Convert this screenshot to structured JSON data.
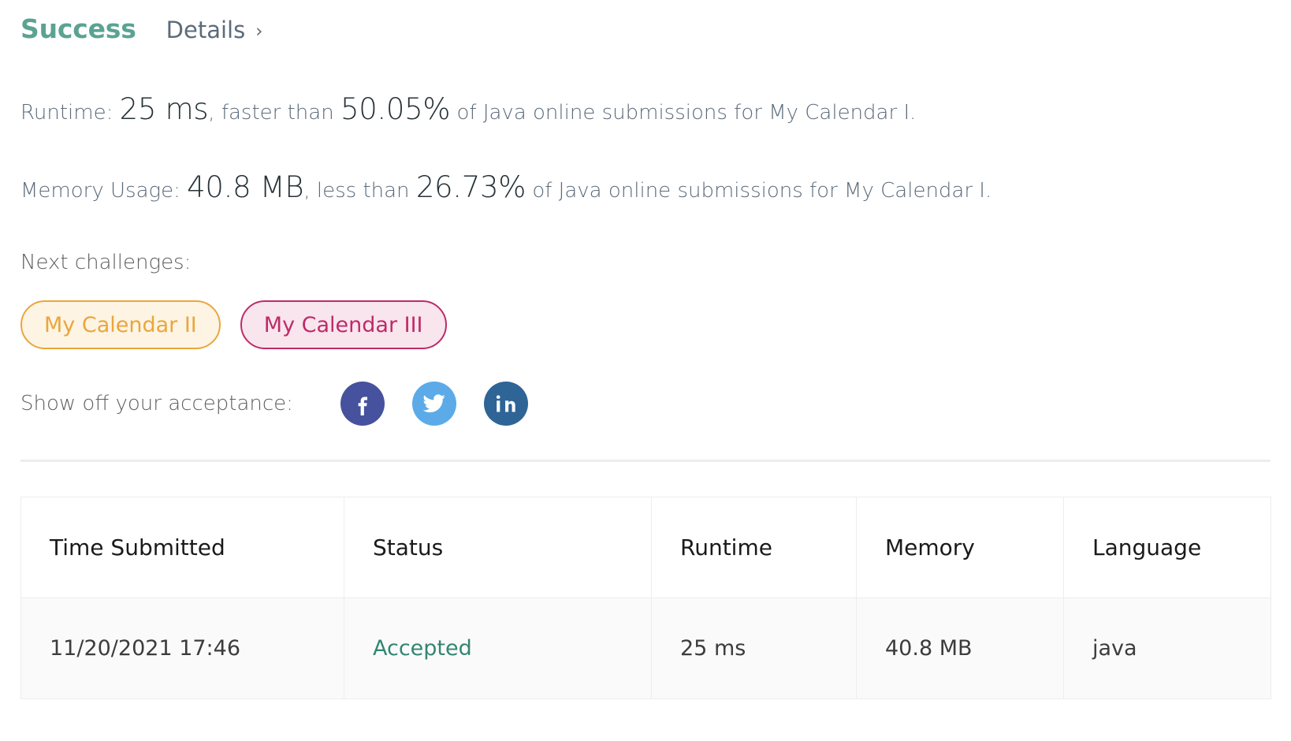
{
  "header": {
    "status": "Success",
    "details_label": "Details",
    "details_chevron": "›"
  },
  "stats": {
    "runtime": {
      "prefix": "Runtime:",
      "value": "25 ms",
      "middle": ", faster than",
      "percent": "50.05%",
      "suffix": "of Java online submissions for My Calendar I."
    },
    "memory": {
      "prefix": "Memory Usage:",
      "value": "40.8 MB",
      "middle": ", less than",
      "percent": "26.73%",
      "suffix": "of Java online submissions for My Calendar I."
    }
  },
  "next_challenges": {
    "label": "Next challenges:",
    "items": [
      {
        "label": "My Calendar II",
        "accent": "#eaa63c",
        "background": "#fdf4e4"
      },
      {
        "label": "My Calendar III",
        "accent": "#be2b68",
        "background": "#f8e5ee"
      }
    ]
  },
  "share": {
    "label": "Show off your acceptance:",
    "networks": [
      {
        "name": "facebook",
        "color": "#46529d"
      },
      {
        "name": "twitter",
        "color": "#5cabe8"
      },
      {
        "name": "linkedin",
        "color": "#2f6496"
      }
    ]
  },
  "submissions_table": {
    "columns": [
      "Time Submitted",
      "Status",
      "Runtime",
      "Memory",
      "Language"
    ],
    "rows": [
      {
        "time_submitted": "11/20/2021 17:46",
        "status": "Accepted",
        "runtime": "25 ms",
        "memory": "40.8 MB",
        "language": "java"
      }
    ]
  },
  "colors": {
    "success": "#5aa393",
    "accepted": "#338573",
    "muted_text": "#5c6b7a",
    "strong_text": "#263238",
    "divider": "#eceded",
    "row_background": "#fafafa"
  }
}
